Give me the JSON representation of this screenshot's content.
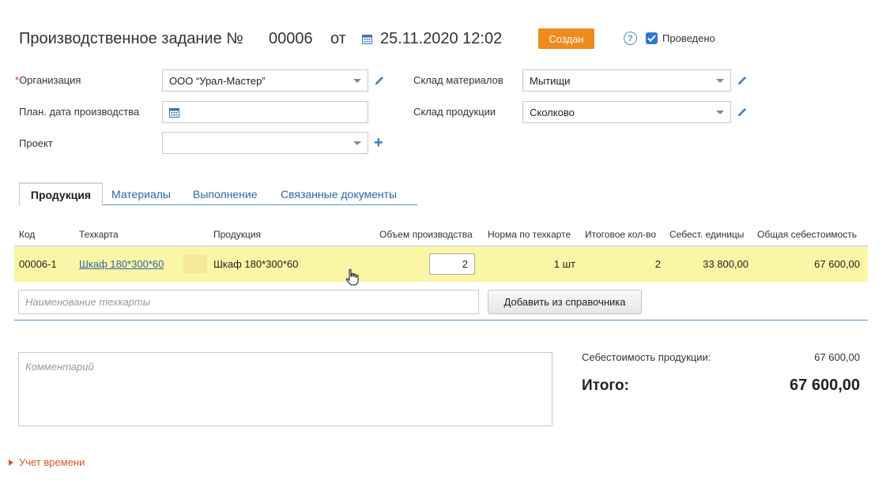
{
  "header": {
    "title": "Производственное задание №",
    "number": "00006",
    "date_prefix": "от",
    "date": "25.11.2020 12:02",
    "status": "Создан",
    "help_glyph": "?",
    "posted_label": "Проведено",
    "posted_checked": true
  },
  "form": {
    "organization": {
      "label": "Организация",
      "required_mark": "*",
      "value": "ООО “Урал-Мастер”"
    },
    "plan_date": {
      "label": "План. дата производства",
      "value": ""
    },
    "project": {
      "label": "Проект",
      "value": "",
      "add_glyph": "+"
    },
    "materials_warehouse": {
      "label": "Склад материалов",
      "value": "Мытищи"
    },
    "products_warehouse": {
      "label": "Склад продукции",
      "value": "Сколково"
    }
  },
  "tabs": [
    {
      "label": "Продукция",
      "active": true
    },
    {
      "label": "Материалы",
      "active": false
    },
    {
      "label": "Выполнение",
      "active": false
    },
    {
      "label": "Связанные документы",
      "active": false
    }
  ],
  "table": {
    "columns": [
      "Код",
      "Техкарта",
      "Продукция",
      "Объем производства",
      "Норма по техкарте",
      "Итоговое кол-во",
      "Себест. единицы",
      "Общая себестоимость"
    ],
    "rows": [
      {
        "code": "00006-1",
        "techcard": "Шкаф 180*300*60",
        "product": "Шкаф 180*300*60",
        "volume": "2",
        "norm": "1 шт",
        "total_qty": "2",
        "unit_cost": "33 800,00",
        "total_cost": "67 600,00"
      }
    ],
    "search_placeholder": "Наименование техкарты",
    "add_button": "Добавить из справочника"
  },
  "comment_placeholder": "Комментарий",
  "summary": {
    "cost_label": "Себестоимость продукции:",
    "cost_value": "67 600,00",
    "total_label": "Итого:",
    "total_value": "67 600,00"
  },
  "time_section": {
    "label": "Учет времени"
  },
  "colors": {
    "status_badge": "#ef8a1c",
    "row_highlight": "#fbf6a6",
    "link": "#2b67a8",
    "accent": "#2d78d6",
    "time_toggle": "#d9531e"
  }
}
